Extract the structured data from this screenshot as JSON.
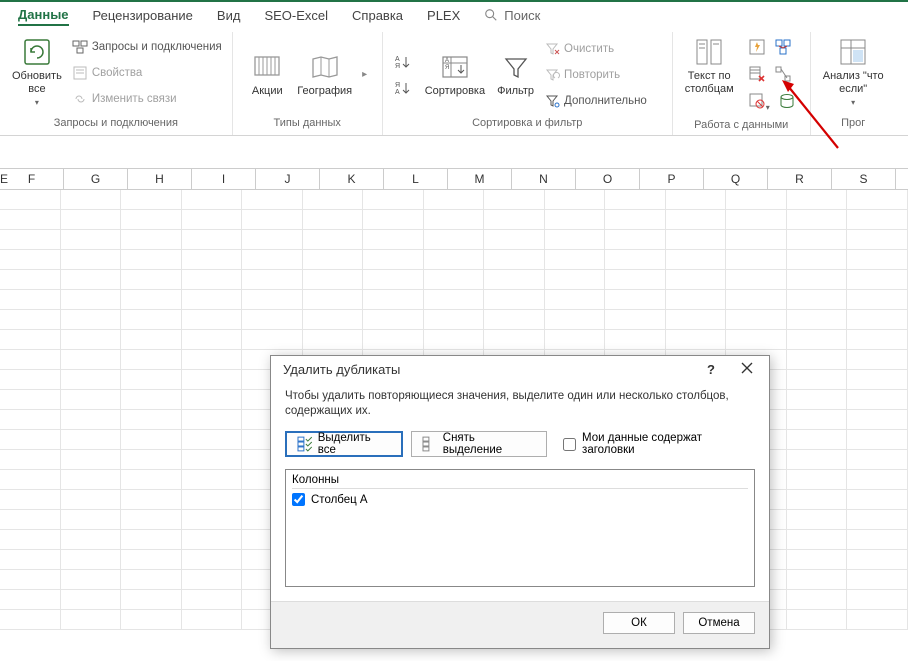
{
  "tabs": [
    "Данные",
    "Рецензирование",
    "Вид",
    "SEO-Excel",
    "Справка",
    "PLEX"
  ],
  "active_tab_index": 0,
  "search_placeholder": "Поиск",
  "ribbon": {
    "g1": {
      "refresh": "Обновить\nвсе",
      "queries": "Запросы и подключения",
      "props": "Свойства",
      "links": "Изменить связи",
      "label": "Запросы и подключения"
    },
    "g2": {
      "stocks": "Акции",
      "geo": "География",
      "label": "Типы данных"
    },
    "g3": {
      "sort": "Сортировка",
      "filter": "Фильтр",
      "clear": "Очистить",
      "reapply": "Повторить",
      "advanced": "Дополнительно",
      "label": "Сортировка и фильтр"
    },
    "g4": {
      "text_to_cols": "Текст по\nстолбцам",
      "label": "Работа с данными"
    },
    "g5": {
      "whatif": "Анализ \"что\nесли\"",
      "label": "Прог"
    }
  },
  "columns": [
    "E",
    "F",
    "G",
    "H",
    "I",
    "J",
    "K",
    "L",
    "M",
    "N",
    "O",
    "P",
    "Q",
    "R",
    "S"
  ],
  "dialog": {
    "title": "Удалить дубликаты",
    "text": "Чтобы удалить повторяющиеся значения, выделите один или несколько столбцов, содержащих их.",
    "select_all": "Выделить все",
    "unselect_all": "Снять выделение",
    "has_headers": "Мои данные содержат заголовки",
    "columns_hdr": "Колонны",
    "col_item": "Столбец A",
    "ok": "ОК",
    "cancel": "Отмена"
  }
}
